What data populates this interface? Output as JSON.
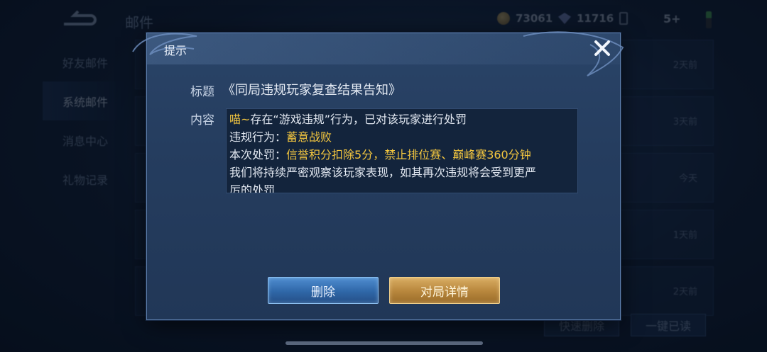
{
  "header": {
    "title": "邮件",
    "coins": "73061",
    "gems": "11716",
    "extra": "5+"
  },
  "sidebar": {
    "items": [
      {
        "label": "好友邮件"
      },
      {
        "label": "系统邮件"
      },
      {
        "label": "消息中心"
      },
      {
        "label": "礼物记录"
      }
    ]
  },
  "mail_list": {
    "times": [
      "2天前",
      "3天前",
      "今天",
      "1天前",
      "2天前"
    ]
  },
  "bottom_actions": {
    "quick_delete": "快速删除",
    "mark_all_read": "一键已读"
  },
  "dialog": {
    "title": "提示",
    "subject_label": "标题",
    "subject": "《同局违规玩家复查结果告知》",
    "content_label": "内容",
    "content": {
      "line1_prefix": "喵~",
      "line1_rest": "存在“游戏违规”行为，已对该玩家进行处罚",
      "line2_label": " 违规行为：",
      "line2_value": "蓄意战败",
      "line3_label": " 本次处罚：",
      "line3_value": "信誉积分扣除5分，禁止排位赛、巅峰赛360分钟",
      "line4": "我们将持续严密观察该玩家表现，如其再次违规将会受到更严",
      "line5": "厉的处罚"
    },
    "delete_label": "删除",
    "detail_label": "对局详情"
  },
  "colors": {
    "highlight": "#f3c63f",
    "delete_button": "#2f67a8",
    "detail_button": "#b7863c"
  }
}
